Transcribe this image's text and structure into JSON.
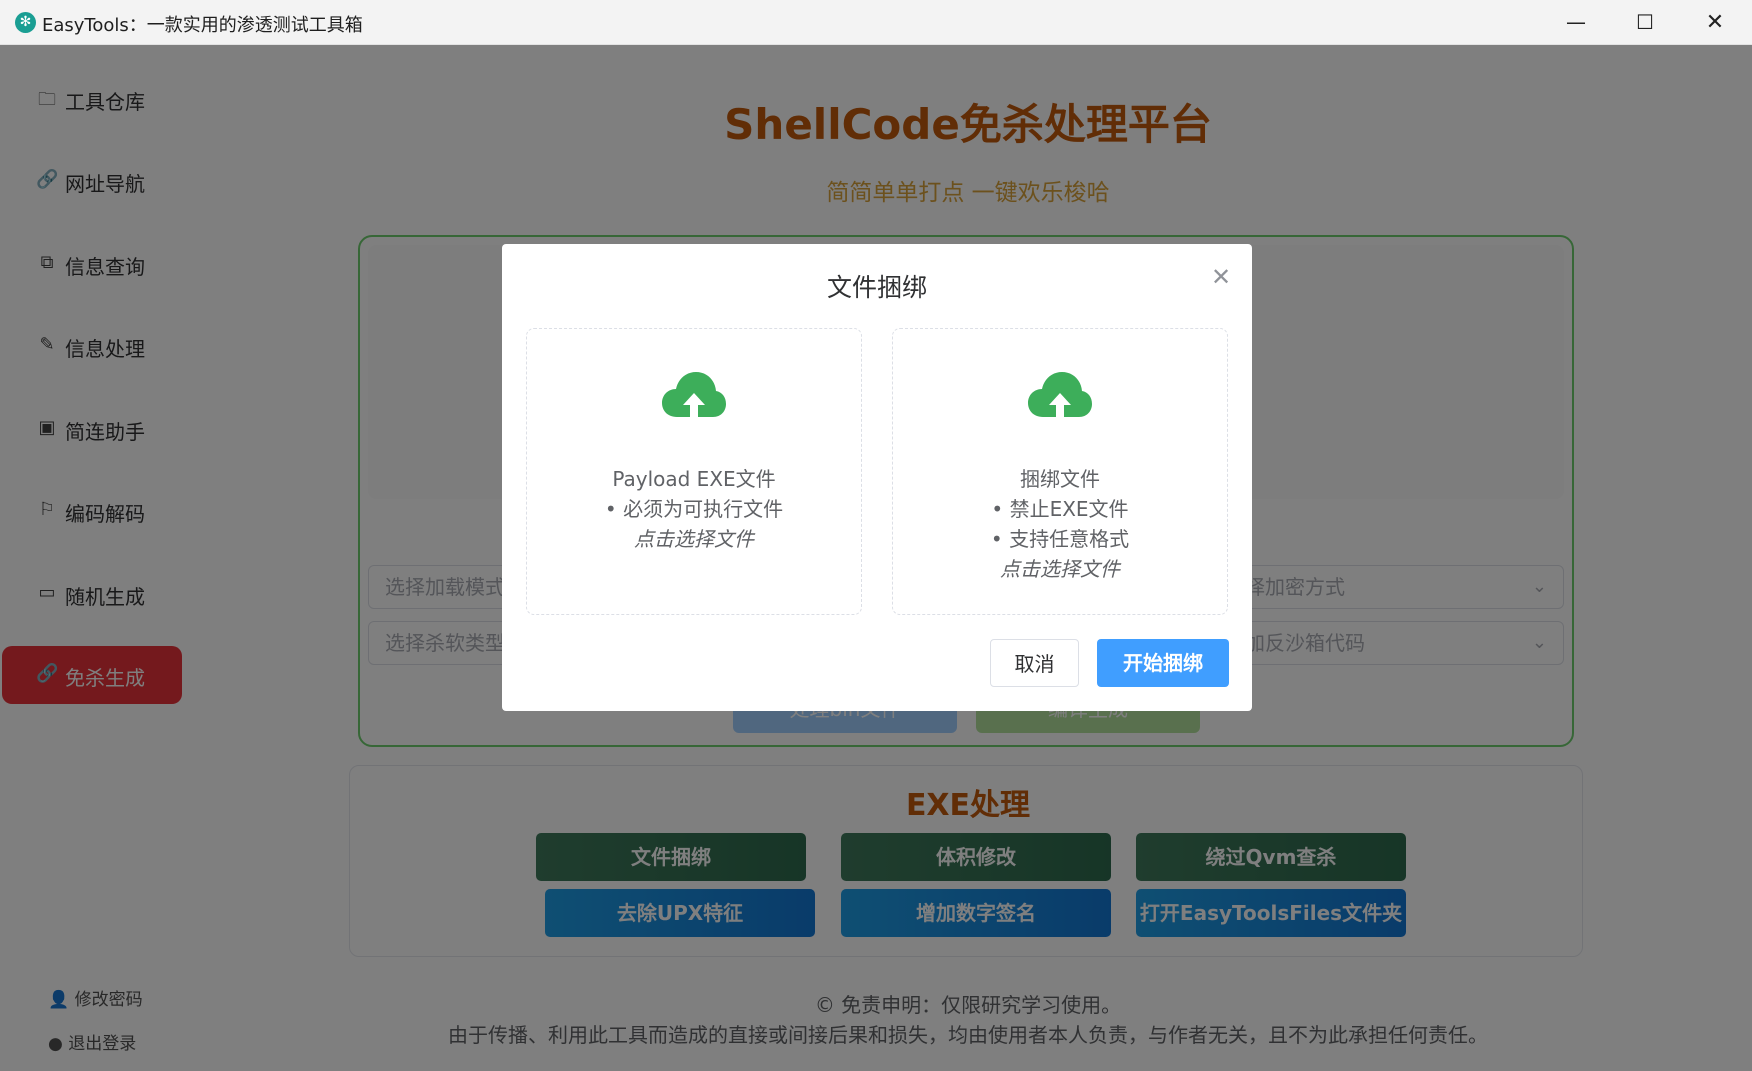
{
  "window": {
    "title": "EasyTools：一款实用的渗透测试工具箱",
    "minimize_glyph": "—",
    "maximize_glyph": "☐",
    "close_glyph": "✕"
  },
  "sidebar": {
    "items": [
      {
        "label": "工具仓库",
        "icon": "briefcase-icon"
      },
      {
        "label": "网址导航",
        "icon": "link-icon"
      },
      {
        "label": "信息查询",
        "icon": "chat-icon"
      },
      {
        "label": "信息处理",
        "icon": "edit-icon"
      },
      {
        "label": "简连助手",
        "icon": "picture-icon"
      },
      {
        "label": "编码解码",
        "icon": "flag-icon"
      },
      {
        "label": "随机生成",
        "icon": "monitor-icon"
      },
      {
        "label": "免杀生成",
        "icon": "link-active-icon"
      }
    ],
    "active_index": 7,
    "footer": {
      "change_password": "修改密码",
      "logout": "退出登录"
    }
  },
  "main": {
    "title": "ShellCode免杀处理平台",
    "subtitle": "简简单单打点 一键欢乐梭哈",
    "selects": {
      "load_mode_placeholder": "选择加载模式",
      "encrypt_placeholder": "选择加密方式",
      "av_type_placeholder": "选择杀软类型",
      "sandbox_placeholder": "添加反沙箱代码"
    },
    "buttons": {
      "process_bin": "处理bin文件",
      "compile": "编译生成"
    },
    "exe_section": {
      "title": "EXE处理",
      "buttons": [
        "文件捆绑",
        "体积修改",
        "绕过Qvm查杀",
        "去除UPX特征",
        "增加数字签名",
        "打开EasyToolsFiles文件夹"
      ]
    },
    "disclaimer": {
      "line1": "© 免责申明：仅限研究学习使用。",
      "line2": "由于传播、利用此工具而造成的直接或间接后果和损失，均由使用者本人负责，与作者无关，且不为此承担任何责任。"
    }
  },
  "modal": {
    "title": "文件捆绑",
    "close_glyph": "✕",
    "upload_payload": {
      "line1": "Payload EXE文件",
      "line2": "• 必须为可执行文件",
      "hint": "点击选择文件"
    },
    "upload_bind": {
      "line1": "捆绑文件",
      "line2": "• 禁止EXE文件",
      "line3": "• 支持任意格式",
      "hint": "点击选择文件"
    },
    "cancel": "取消",
    "confirm": "开始捆绑"
  },
  "colors": {
    "accent_orange": "#c25a0c",
    "active_red": "#e9323b",
    "primary_blue": "#409eff",
    "upload_green": "#3dae5a",
    "panel_green": "#6fcf6f"
  }
}
